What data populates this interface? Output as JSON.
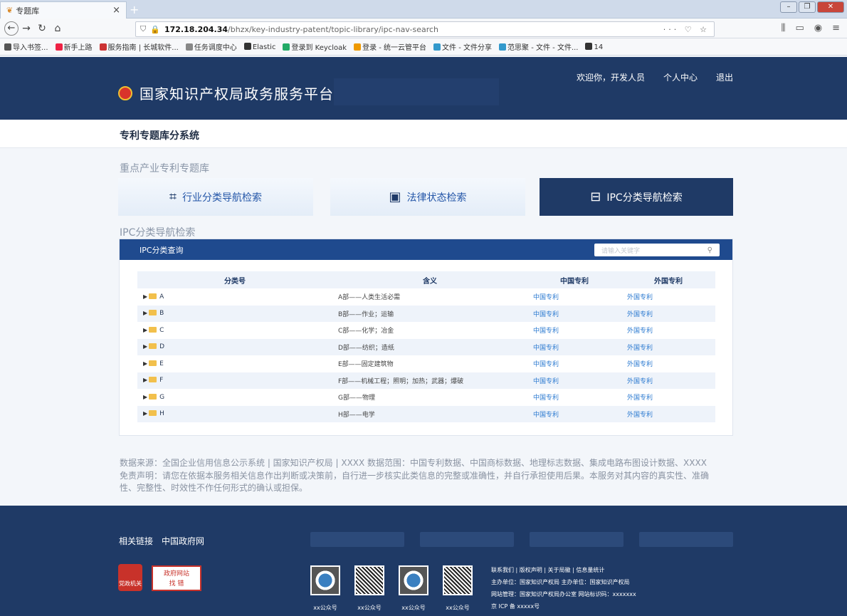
{
  "browser": {
    "tab_title": "专题库",
    "tab_close": "×",
    "new_tab": "+",
    "url_host": "172.18.204.34",
    "url_path": "/bhzx/key-industry-patent/topic-library/ipc-nav-search",
    "url_actions": "··· ♡ ☆",
    "bookmarks": [
      "导入书签...",
      "新手上路",
      "服务指南 | 长城软件...",
      "任务调度中心",
      "Elastic",
      "登录到 Keycloak",
      "登录 - 统一云管平台",
      "文件 - 文件分享",
      "范思聚 - 文件 - 文件...",
      "14"
    ]
  },
  "header": {
    "site_title": "国家知识产权局政务服务平台",
    "welcome": "欢迎你，开发人员",
    "personal_center": "个人中心",
    "logout": "退出"
  },
  "subheader": {
    "title": "专利专题库分系统"
  },
  "section": {
    "label": "重点产业专利专题库",
    "ipc_label": "IPC分类导航检索"
  },
  "categories": [
    {
      "label": "行业分类导航检索",
      "icon": "grid-search-icon"
    },
    {
      "label": "法律状态检索",
      "icon": "document-search-icon"
    },
    {
      "label": "IPC分类导航检索",
      "icon": "ipc-search-icon",
      "active": true
    }
  ],
  "panel": {
    "title": "IPC分类查询",
    "search_placeholder": "请输入关键字",
    "columns": [
      "分类号",
      "含义",
      "中国专利",
      "外国专利"
    ],
    "rows": [
      {
        "code": "A",
        "meaning": "A部——人类生活必需",
        "cn": "中国专利",
        "foreign": "外国专利"
      },
      {
        "code": "B",
        "meaning": "B部——作业；运输",
        "cn": "中国专利",
        "foreign": "外国专利"
      },
      {
        "code": "C",
        "meaning": "C部——化学；冶金",
        "cn": "中国专利",
        "foreign": "外国专利"
      },
      {
        "code": "D",
        "meaning": "D部——纺织；造纸",
        "cn": "中国专利",
        "foreign": "外国专利"
      },
      {
        "code": "E",
        "meaning": "E部——固定建筑物",
        "cn": "中国专利",
        "foreign": "外国专利"
      },
      {
        "code": "F",
        "meaning": "F部——机械工程；照明；加热；武器；爆破",
        "cn": "中国专利",
        "foreign": "外国专利"
      },
      {
        "code": "G",
        "meaning": "G部——物理",
        "cn": "中国专利",
        "foreign": "外国专利"
      },
      {
        "code": "H",
        "meaning": "H部——电学",
        "cn": "中国专利",
        "foreign": "外国专利"
      }
    ]
  },
  "footnote": {
    "line1": "数据来源：全国企业信用信息公示系统 | 国家知识产权局 | XXXX      数据范围：中国专利数据、中国商标数据、地理标志数据、集成电路布图设计数据、XXXX",
    "line2": "免责声明：请您在依据本服务相关信息作出判断或决策前，自行进一步核实此类信息的完整或准确性，并自行承担使用后果。本服务对其内容的真实性、准确",
    "line3": "性、完整性、时效性不作任何形式的确认或担保。"
  },
  "footer": {
    "related_links": "相关链接",
    "gov_site": "中国政府网",
    "badge1": "党政机关",
    "badge2_line1": "政府网站",
    "badge2_line2": "找 错",
    "qr_labels": [
      "xx公众号",
      "xx公众号",
      "xx公众号",
      "xx公众号"
    ],
    "info_line1": "联系我们  |  版权声明  |  关于局徽  |  信息量统计",
    "info_line2": "主办单位：国家知识产权局       主办单位：国家知识产权局",
    "info_line3": "网站管理：国家知识产权局办公室   网站标识码：xxxxxxx",
    "info_line4": "京 ICP 备 xxxxx号"
  }
}
